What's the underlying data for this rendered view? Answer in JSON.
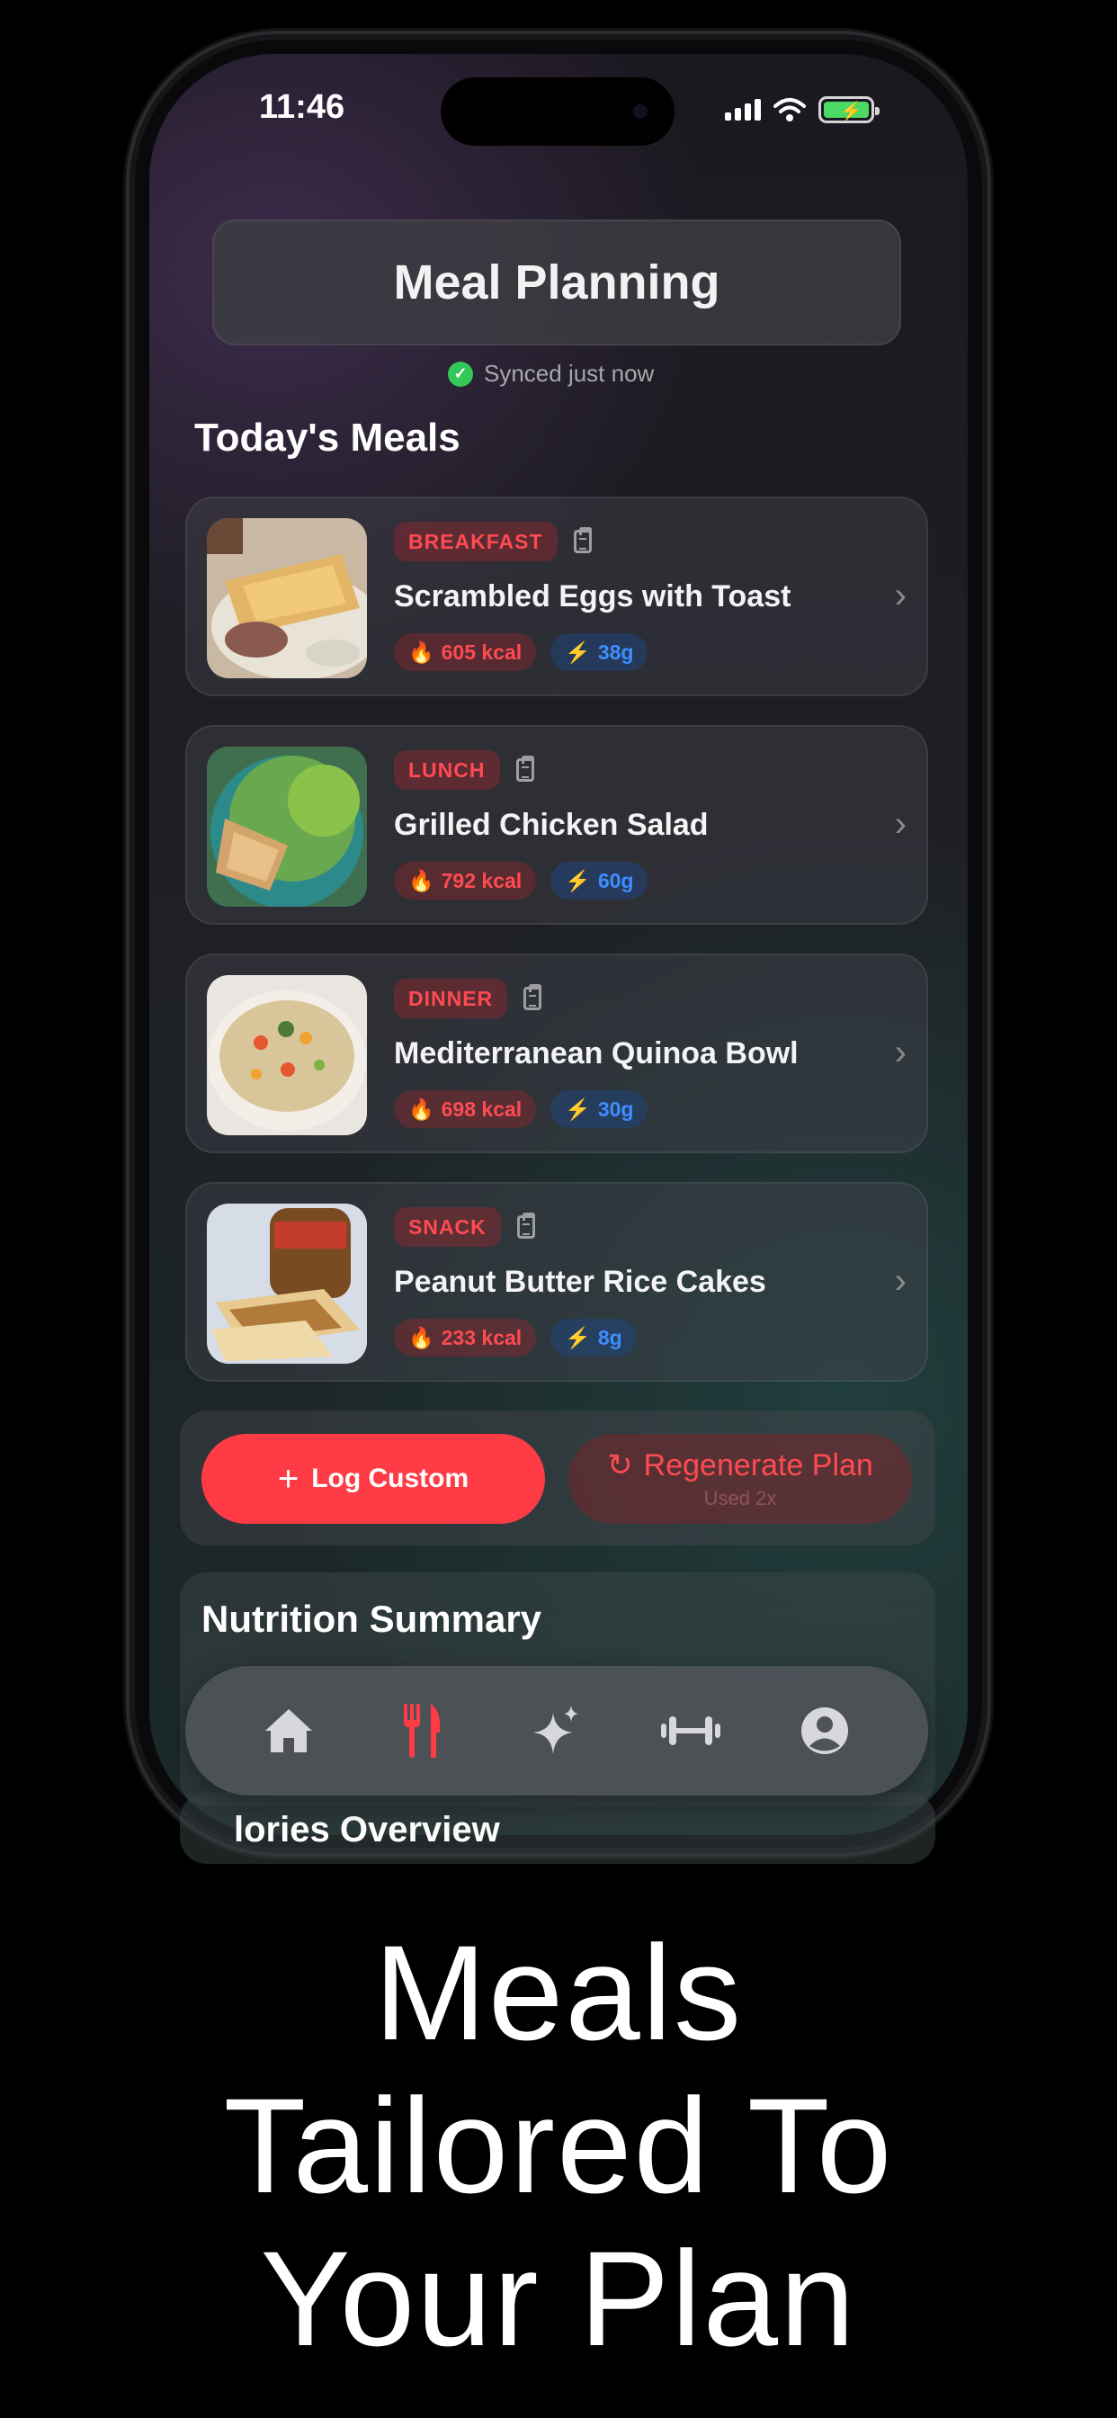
{
  "status_bar": {
    "time": "11:46"
  },
  "header": {
    "title": "Meal Planning",
    "sync_status": "Synced just now"
  },
  "section_title": "Today's Meals",
  "meals": [
    {
      "type": "BREAKFAST",
      "name": "Scrambled Eggs with Toast",
      "calories": "605 kcal",
      "protein": "38g"
    },
    {
      "type": "LUNCH",
      "name": "Grilled Chicken Salad",
      "calories": "792 kcal",
      "protein": "60g"
    },
    {
      "type": "DINNER",
      "name": "Mediterranean Quinoa Bowl",
      "calories": "698 kcal",
      "protein": "30g"
    },
    {
      "type": "SNACK",
      "name": "Peanut Butter Rice Cakes",
      "calories": "233 kcal",
      "protein": "8g"
    }
  ],
  "actions": {
    "log_custom": "Log Custom",
    "regenerate": "Regenerate Plan",
    "regenerate_sub": "Used 2x"
  },
  "nutrition": {
    "title": "Nutrition Summary",
    "overview_partial": "lories Overview"
  },
  "tabbar": {
    "items": [
      "home-icon",
      "fork-knife-icon",
      "sparkles-icon",
      "dumbbell-icon",
      "profile-icon"
    ],
    "active_index": 1
  },
  "colors": {
    "accent": "#ff3b45",
    "protein": "#3d8dff",
    "success": "#34c759"
  },
  "tagline": [
    "Meals",
    "Tailored To",
    "Your Plan"
  ]
}
